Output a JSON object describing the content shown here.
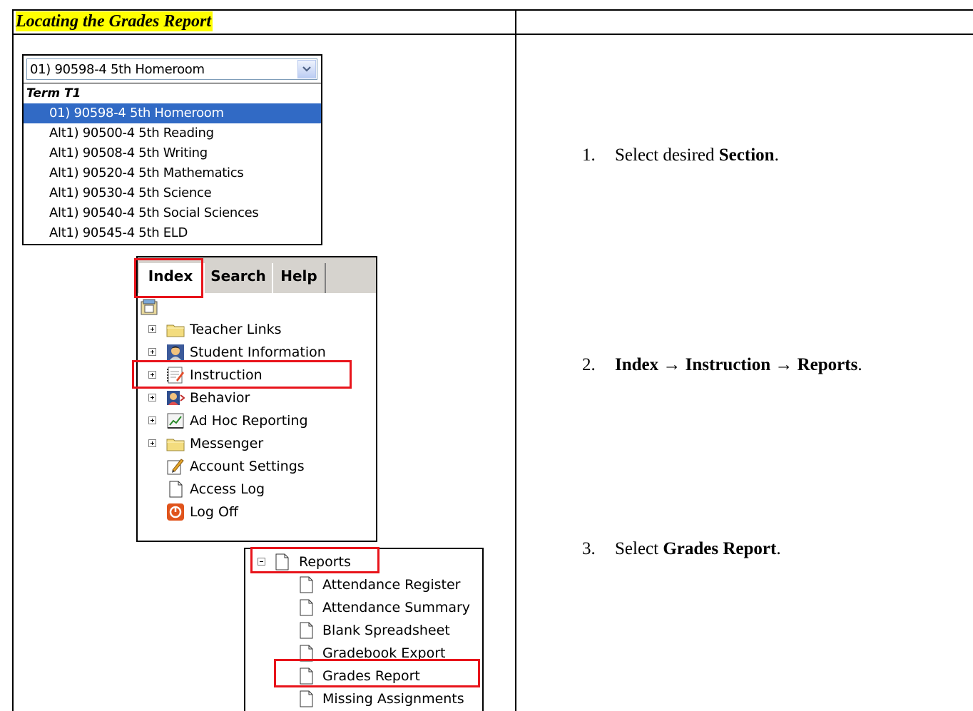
{
  "document": {
    "title": "Locating the Grades Report",
    "steps": [
      {
        "num": "1.",
        "pre": "Select desired ",
        "bold": "Section",
        "post": "."
      },
      {
        "num": "2.",
        "seq": [
          "Index",
          "Instruction",
          "Reports"
        ],
        "arrow": "→",
        "post": "."
      },
      {
        "num": "3.",
        "pre": "Select ",
        "bold": "Grades Report",
        "post": "."
      }
    ]
  },
  "section_dropdown": {
    "selected_value": "01) 90598-4 5th Homeroom",
    "group_label": "Term T1",
    "options": [
      "01) 90598-4 5th Homeroom",
      "Alt1) 90500-4 5th Reading",
      "Alt1) 90508-4 5th Writing",
      "Alt1) 90520-4 5th Mathematics",
      "Alt1) 90530-4 5th Science",
      "Alt1) 90540-4 5th Social Sciences",
      "Alt1) 90545-4 5th ELD"
    ]
  },
  "index_panel": {
    "tabs": [
      "Index",
      "Search",
      "Help"
    ],
    "tree": [
      {
        "label": "Teacher Links",
        "icon": "folder-icon"
      },
      {
        "label": "Student Information",
        "icon": "student-icon"
      },
      {
        "label": "Instruction",
        "icon": "notebook-icon"
      },
      {
        "label": "Behavior",
        "icon": "behavior-icon"
      },
      {
        "label": "Ad Hoc Reporting",
        "icon": "chart-icon"
      },
      {
        "label": "Messenger",
        "icon": "folder-icon"
      },
      {
        "label": "Account Settings",
        "icon": "edit-icon"
      },
      {
        "label": "Access Log",
        "icon": "page-icon"
      },
      {
        "label": "Log Off",
        "icon": "power-icon"
      }
    ]
  },
  "reports_panel": {
    "label": "Reports",
    "items": [
      "Attendance Register",
      "Attendance Summary",
      "Blank Spreadsheet",
      "Gradebook Export",
      "Grades Report",
      "Missing Assignments"
    ]
  },
  "colors": {
    "highlight_box": "#e8141b",
    "title_highlight": "#ffff00",
    "selection": "#316ac5"
  }
}
